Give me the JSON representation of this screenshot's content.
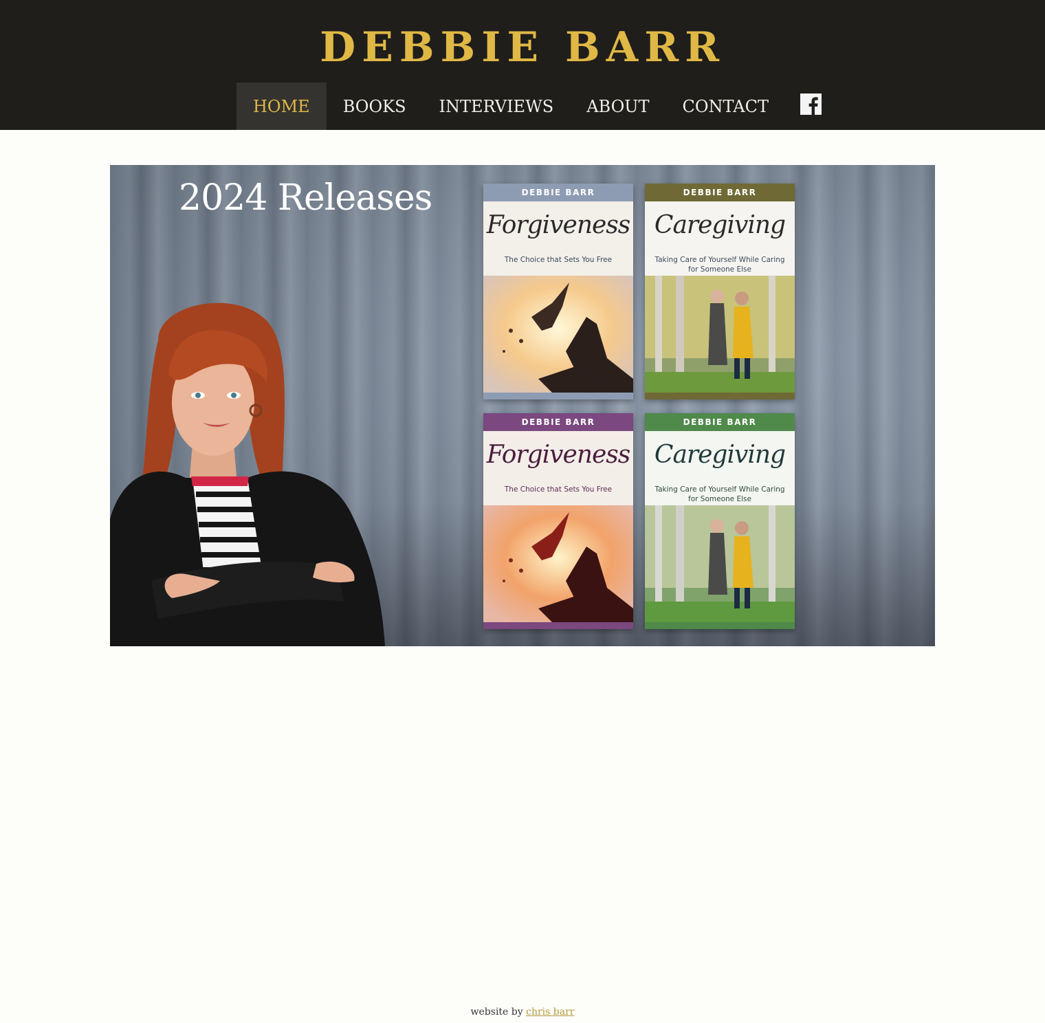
{
  "site": {
    "title": "DEBBIE BARR"
  },
  "nav": {
    "items": [
      {
        "label": "HOME",
        "active": true
      },
      {
        "label": "BOOKS",
        "active": false
      },
      {
        "label": "INTERVIEWS",
        "active": false
      },
      {
        "label": "ABOUT",
        "active": false
      },
      {
        "label": "CONTACT",
        "active": false
      }
    ],
    "social_icon": "facebook-icon"
  },
  "hero": {
    "title": "2024 Releases",
    "books": [
      {
        "author": "DEBBIE BARR",
        "title": "Forgiveness",
        "subtitle": "The Choice that Sets You Free",
        "band_color": "#8e9cb3"
      },
      {
        "author": "DEBBIE BARR",
        "title": "Caregiving",
        "subtitle": "Taking Care of Yourself While Caring for Someone Else",
        "band_color": "#6f6a35"
      },
      {
        "author": "DEBBIE BARR",
        "title": "Forgiveness",
        "subtitle": "The Choice that Sets You Free",
        "band_color": "#7b4880"
      },
      {
        "author": "DEBBIE BARR",
        "title": "Caregiving",
        "subtitle": "Taking Care of Yourself While Caring for Someone Else",
        "band_color": "#4f8a4a"
      }
    ]
  },
  "footer": {
    "prefix": "website by",
    "link_label": "chris barr"
  },
  "colors": {
    "header_bg": "#201e1b",
    "accent_gold": "#dfb845",
    "page_bg": "#fdfdfa"
  }
}
